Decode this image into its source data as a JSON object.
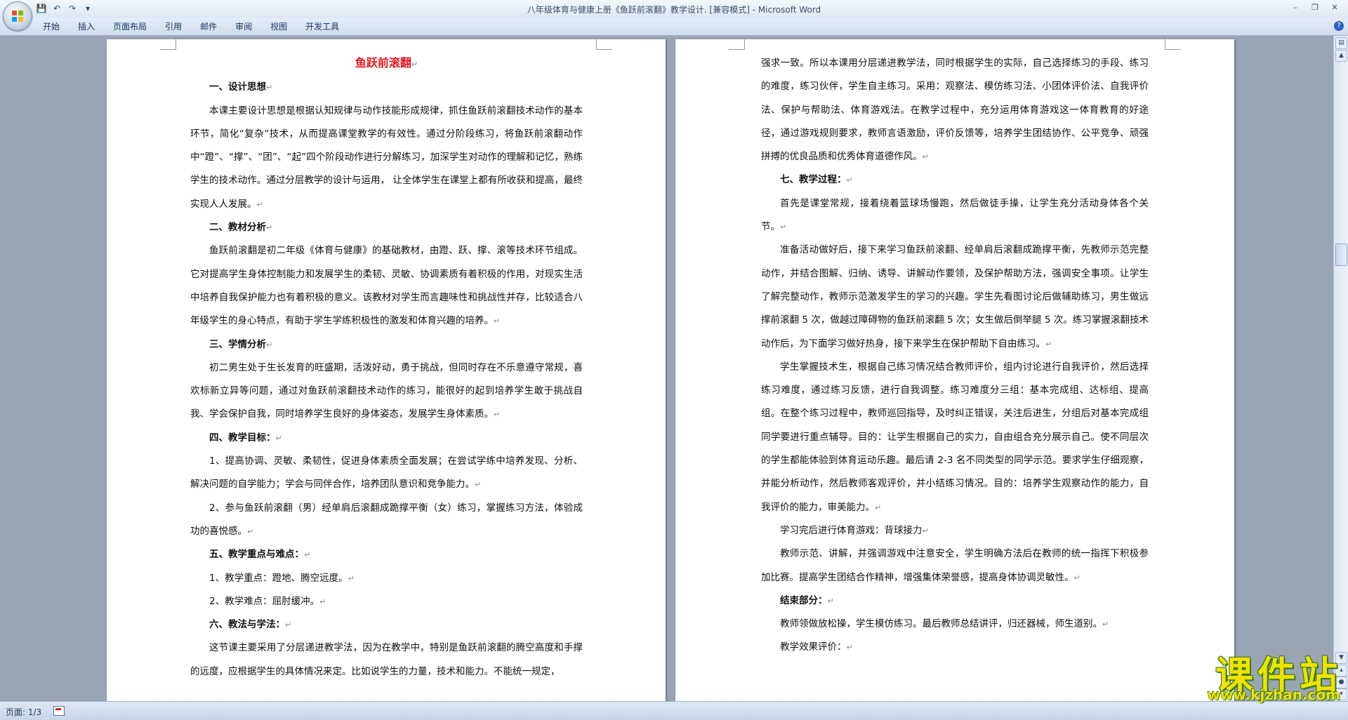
{
  "window": {
    "title": "八年级体育与健康上册《鱼跃前滚翻》教学设计. [兼容模式] - Microsoft Word",
    "controls": [
      "–",
      "❐",
      "✕"
    ]
  },
  "qat": {
    "save": "💾",
    "undo": "↶",
    "redo": "↷",
    "customize": "▾"
  },
  "ribbon": {
    "tabs": [
      "开始",
      "插入",
      "页面布局",
      "引用",
      "邮件",
      "审阅",
      "视图",
      "开发工具"
    ],
    "help": "?"
  },
  "status": {
    "page": "页面: 1/3"
  },
  "watermark": {
    "title": "课件站",
    "url": "www.kjzhan.com"
  },
  "page1": {
    "paragraphs": [
      {
        "style": "title",
        "text": "鱼跃前滚翻",
        "mark": "↵"
      },
      {
        "style": "heading",
        "text": "一、设计思想",
        "mark": "↵"
      },
      {
        "style": "indent",
        "text": "本课主要设计思想是根据认知规律与动作技能形成规律，抓住鱼跃前滚翻技术动作的基本环节，简化“复杂”技术，从而提高课堂教学的有效性。通过分阶段练习，将鱼跃前滚翻动作中“蹬”、“撑”、“团”、“起”四个阶段动作进行分解练习，加深学生对动作的理解和记忆，熟练学生的技术动作。通过分层教学的设计与运用， 让全体学生在课堂上都有所收获和提高，最终实现人人发展。",
        "mark": "↵"
      },
      {
        "style": "heading",
        "text": "二、教材分析",
        "mark": "↵"
      },
      {
        "style": "indent",
        "text": "鱼跃前滚翻是初二年级《体育与健康》的基础教材，由蹬、跃、撑、滚等技术环节组成。它对提高学生身体控制能力和发展学生的柔韧、灵敏、协调素质有着积极的作用，对现实生活中培养自我保护能力也有着积极的意义。该教材对学生而言趣味性和挑战性并存，比较适合八年级学生的身心特点，有助于学生学练积极性的激发和体育兴趣的培养。",
        "mark": "↵"
      },
      {
        "style": "heading",
        "text": "三、学情分析",
        "mark": "↵"
      },
      {
        "style": "indent",
        "text": "初二男生处于生长发育的旺盛期，活泼好动，勇于挑战，但同时存在不乐意遵守常规，喜欢标新立异等问题，通过对鱼跃前滚翻技术动作的练习，能很好的起到培养学生敢于挑战自我、学会保护自我，同时培养学生良好的身体姿态，发展学生身体素质。",
        "mark": "↵"
      },
      {
        "style": "heading",
        "text": "四、教学目标：",
        "mark": "↵"
      },
      {
        "style": "indent",
        "text": "1、提高协调、灵敏、柔韧性，促进身体素质全面发展；在尝试学练中培养发现、分析、解决问题的自学能力；学会与同伴合作，培养团队意识和竞争能力。",
        "mark": "↵"
      },
      {
        "style": "indent",
        "text": "2、参与鱼跃前滚翻（男）经单肩后滚翻成跪撑平衡（女）练习，掌握练习方法，体验成功的喜悦感。",
        "mark": "↵"
      },
      {
        "style": "heading",
        "text": "五、教学重点与难点：",
        "mark": "↵"
      },
      {
        "style": "indent",
        "text": "1、教学重点：蹬地、腾空远度。",
        "mark": "↵"
      },
      {
        "style": "indent",
        "text": "2、教学难点：屈肘缓冲。",
        "mark": "↵"
      },
      {
        "style": "heading",
        "text": "六、教法与学法：",
        "mark": "↵"
      },
      {
        "style": "indent",
        "text": "这节课主要采用了分层递进教学法，因为在教学中，特别是鱼跃前滚翻的腾空高度和手撑的远度，应根据学生的具体情况来定。比如说学生的力量，技术和能力。不能统一规定，",
        "mark": ""
      }
    ]
  },
  "page2": {
    "paragraphs": [
      {
        "style": "plain",
        "text": "强求一致。所以本课用分层递进教学法，同时根据学生的实际，自己选择练习的手段、练习的难度，练习伙伴，学生自主练习。采用：观察法、模仿练习法、小团体评价法、自我评价法、保护与帮助法、体育游戏法。在教学过程中，充分运用体育游戏这一体育教育的好途径，通过游戏规则要求，教师言语激励，评价反馈等，培养学生团结协作、公平竞争、顽强拼搏的优良品质和优秀体育道德作风。",
        "mark": "↵"
      },
      {
        "style": "heading",
        "text": "七、教学过程：",
        "mark": "↵"
      },
      {
        "style": "indent",
        "text": "首先是课堂常规，接着绕着篮球场慢跑，然后做徒手操，让学生充分活动身体各个关节。",
        "mark": "↵"
      },
      {
        "style": "indent",
        "text": "准备活动做好后，接下来学习鱼跃前滚翻、经单肩后滚翻成跪撑平衡，先教师示范完整动作，并结合图解、归纳、诱导、讲解动作要领，及保护帮助方法，强调安全事项。让学生了解完整动作，教师示范激发学生的学习的兴趣。学生先看图讨论后做辅助练习，男生做远撑前滚翻 5 次，做越过障碍物的鱼跃前滚翻 5 次；女生做后倒举腿 5 次。练习掌握滚翻技术动作后，为下面学习做好热身，接下来学生在保护帮助下自由练习。",
        "mark": "↵"
      },
      {
        "style": "indent",
        "text": "学生掌握技术生，根据自己练习情况结合教师评价，组内讨论进行自我评价，然后选择练习难度，通过练习反馈，进行自我调整。练习难度分三组：基本完成组、达标组、提高组。在整个练习过程中，教师巡回指导，及时纠正错误，关注后进生，分组后对基本完成组同学要进行重点辅导。目的：让学生根据自己的实力，自由组合充分展示自己。使不同层次的学生都能体验到体育运动乐趣。最后请 2-3 名不同类型的同学示范。要求学生仔细观察，并能分析动作，然后教师客观评价，并小结练习情况。目的：培养学生观察动作的能力，自我评价的能力，审美能力。",
        "mark": "↵"
      },
      {
        "style": "indent",
        "text": "学习完后进行体育游戏：背球接力",
        "mark": "↵"
      },
      {
        "style": "indent",
        "text": "教师示范、讲解，并强调游戏中注意安全，学生明确方法后在教师的统一指挥下积极参加比赛。提高学生团结合作精神，增强集体荣誉感，提高身体协调灵敏性。",
        "mark": "↵"
      },
      {
        "style": "heading",
        "text": "结束部分：",
        "mark": "↵"
      },
      {
        "style": "indent",
        "text": "教师领做放松操，学生模仿练习。最后教师总结讲评，归还器械，师生道别。",
        "mark": "↵"
      },
      {
        "style": "indent",
        "text": "教学效果评价：",
        "mark": "↵"
      }
    ]
  }
}
